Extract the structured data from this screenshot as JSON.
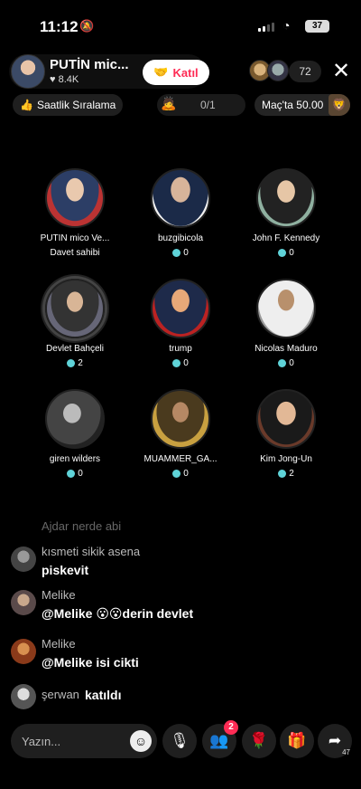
{
  "status_bar": {
    "time": "11:12",
    "battery": "37"
  },
  "header": {
    "host_name": "PUTİN mic...",
    "host_likes": "8.4K",
    "join_label": "Katıl",
    "viewer_count": "72"
  },
  "subheader": {
    "ranking_label": "Saatlik Sıralama",
    "goal_value": "0/1",
    "match_label": "Maç'ta 50.00"
  },
  "guests": [
    {
      "name": "PUTİN mico Ve...",
      "score": "Davet sahibi",
      "is_host": true
    },
    {
      "name": "buzgibicola",
      "score": "0"
    },
    {
      "name": "John F. Kennedy",
      "score": "0"
    },
    {
      "name": "Devlet Bahçeli",
      "score": "2"
    },
    {
      "name": "trump",
      "score": "0"
    },
    {
      "name": "Nicolas Maduro",
      "score": "0"
    },
    {
      "name": "giren wilders",
      "score": "0"
    },
    {
      "name": "MUAMMER_GA...",
      "score": "0"
    },
    {
      "name": "Kim Jong-Un",
      "score": "2"
    }
  ],
  "chat": [
    {
      "user": "Ajdar nerde abi",
      "text": ""
    },
    {
      "user": "kısmeti sikik asena",
      "text": "piskevit"
    },
    {
      "user": "Melike",
      "text": "@Melike 😮😮derin devlet"
    },
    {
      "user": "Melike",
      "text": "@Melike isi cikti"
    },
    {
      "user": "şerwan",
      "text": "katıldı"
    }
  ],
  "bottom_bar": {
    "input_placeholder": "Yazın...",
    "guests_badge": "2",
    "share_count": "47"
  },
  "colors": {
    "accent": "#fe2c55",
    "coin": "#5fd3d8",
    "background": "#000000"
  }
}
